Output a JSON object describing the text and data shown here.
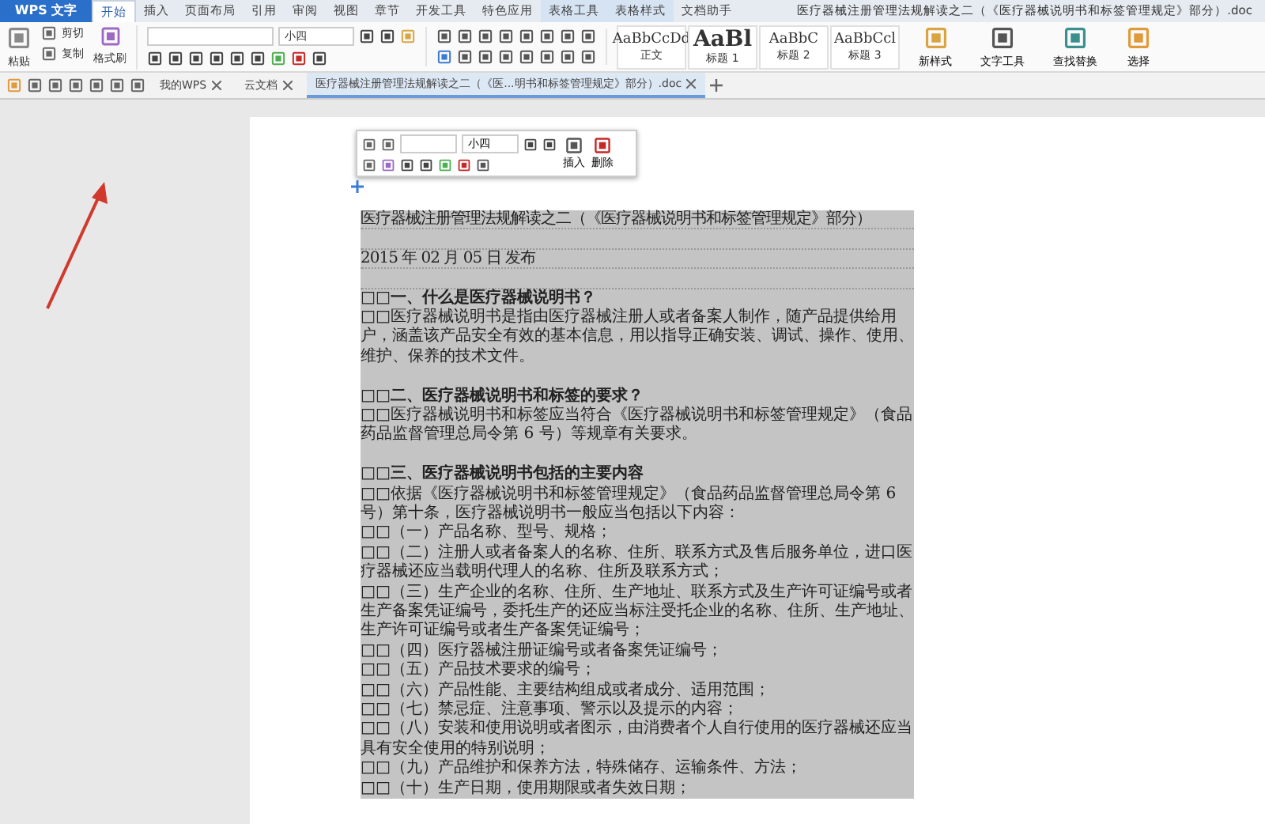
{
  "app_button": {
    "label": "WPS 文字"
  },
  "menu_tabs": [
    {
      "label": "开始",
      "selected": true
    },
    {
      "label": "插入",
      "selected": false
    },
    {
      "label": "页面布局",
      "selected": false
    },
    {
      "label": "引用",
      "selected": false
    },
    {
      "label": "审阅",
      "selected": false
    },
    {
      "label": "视图",
      "selected": false
    },
    {
      "label": "章节",
      "selected": false
    },
    {
      "label": "开发工具",
      "selected": false
    },
    {
      "label": "特色应用",
      "selected": false
    },
    {
      "label": "表格工具",
      "selected": false
    },
    {
      "label": "表格样式",
      "selected": false
    },
    {
      "label": "文档助手",
      "selected": false
    }
  ],
  "window_title": "医疗器械注册管理法规解读之二（《医疗器械说明书和标签管理规定》部分）.doc",
  "ribbon": {
    "paste": "粘贴",
    "cut": "剪切",
    "copy": "复制",
    "format_painter": "格式刷",
    "font_size": "小四",
    "styles": [
      {
        "sample": "AaBbCcDd",
        "label": "正文"
      },
      {
        "sample": "AaBl",
        "label": "标题 1"
      },
      {
        "sample": "AaBbC",
        "label": "标题 2"
      },
      {
        "sample": "AaBbCcl",
        "label": "标题 3"
      }
    ],
    "tools": [
      {
        "label": "新样式"
      },
      {
        "label": "文字工具"
      },
      {
        "label": "查找替换"
      },
      {
        "label": "选择"
      }
    ]
  },
  "doc_tabs": [
    {
      "label": "我的WPS",
      "selected": false
    },
    {
      "label": "云文档",
      "selected": false
    },
    {
      "label": "医疗器械注册管理法规解读之二（《医...明书和标签管理规定》部分）.doc",
      "selected": true
    }
  ],
  "floating_toolbar": {
    "font_size": "小四",
    "insert": "插入",
    "delete": "删除"
  },
  "document": {
    "selected": true,
    "table_rows": [
      {
        "kind": "text",
        "text": "医疗器械注册管理法规解读之二（《医疗器械说明书和标签管理规定》部分）"
      },
      {
        "kind": "blank"
      },
      {
        "kind": "text",
        "text": "2015 年 02 月 05 日 发布"
      },
      {
        "kind": "blank"
      }
    ],
    "paragraphs": [
      {
        "kind": "heading",
        "text": "□□一、什么是医疗器械说明书？"
      },
      {
        "kind": "body",
        "text": "□□医疗器械说明书是指由医疗器械注册人或者备案人制作，随产品提供给用户，涵盖该产品安全有效的基本信息，用以指导正确安装、调试、操作、使用、维护、保养的技术文件。"
      },
      {
        "kind": "blank"
      },
      {
        "kind": "heading",
        "text": "□□二、医疗器械说明书和标签的要求？"
      },
      {
        "kind": "body",
        "text": "□□医疗器械说明书和标签应当符合《医疗器械说明书和标签管理规定》（食品药品监督管理总局令第 6 号）等规章有关要求。"
      },
      {
        "kind": "blank"
      },
      {
        "kind": "heading",
        "text": "□□三、医疗器械说明书包括的主要内容"
      },
      {
        "kind": "body",
        "text": "□□依据《医疗器械说明书和标签管理规定》（食品药品监督管理总局令第 6 号）第十条，医疗器械说明书一般应当包括以下内容："
      },
      {
        "kind": "body",
        "text": "□□（一）产品名称、型号、规格；"
      },
      {
        "kind": "body",
        "text": "□□（二）注册人或者备案人的名称、住所、联系方式及售后服务单位，进口医疗器械还应当载明代理人的名称、住所及联系方式；"
      },
      {
        "kind": "body",
        "text": "□□（三）生产企业的名称、住所、生产地址、联系方式及生产许可证编号或者生产备案凭证编号，委托生产的还应当标注受托企业的名称、住所、生产地址、生产许可证编号或者生产备案凭证编号；"
      },
      {
        "kind": "body",
        "text": "□□（四）医疗器械注册证编号或者备案凭证编号；"
      },
      {
        "kind": "body",
        "text": "□□（五）产品技术要求的编号；"
      },
      {
        "kind": "body",
        "text": "□□（六）产品性能、主要结构组成或者成分、适用范围；"
      },
      {
        "kind": "body",
        "text": "□□（七）禁忌症、注意事项、警示以及提示的内容；"
      },
      {
        "kind": "body",
        "text": "□□（八）安装和使用说明或者图示，由消费者个人自行使用的医疗器械还应当具有安全使用的特别说明；"
      },
      {
        "kind": "body",
        "text": "□□（九）产品维护和保养方法，特殊储存、运输条件、方法；"
      },
      {
        "kind": "body",
        "text": "□□（十）生产日期，使用期限或者失效日期；"
      }
    ]
  }
}
